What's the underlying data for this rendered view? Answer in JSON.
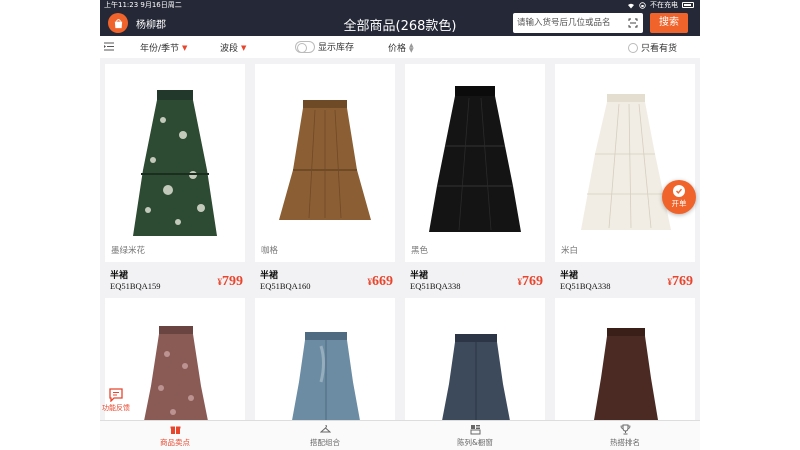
{
  "status": {
    "time_date": "上午11:23   9月16日周二",
    "charging": "不在充电"
  },
  "nav": {
    "user": "杨柳郡",
    "title": "全部商品(268款色)",
    "search_placeholder": "请输入货号后几位或品名",
    "search_button": "搜索"
  },
  "filters": {
    "season": "年份/季节",
    "wave": "波段",
    "show_stock": "显示库存",
    "price": "价格",
    "only_in_stock": "只看有货"
  },
  "products": [
    {
      "color": "墨绿米花",
      "category": "半裙",
      "code": "EQ51BQA159",
      "price": "799",
      "swatch": "#2d4a32"
    },
    {
      "color": "咖格",
      "category": "半裙",
      "code": "EQ51BQA160",
      "price": "669",
      "swatch": "#8b5e34"
    },
    {
      "color": "黑色",
      "category": "半裙",
      "code": "EQ51BQA338",
      "price": "769",
      "swatch": "#141414"
    },
    {
      "color": "米白",
      "category": "半裙",
      "code": "EQ51BQA338",
      "price": "769",
      "swatch": "#f1ede4"
    }
  ],
  "row2_swatches": [
    "#8a5a55",
    "#6b8ca3",
    "#3c4a5c",
    "#4a2a22"
  ],
  "currency": "¥",
  "floating": {
    "kaidan": "开单",
    "feedback": "功能反馈"
  },
  "tabs": [
    {
      "label": "商品卖点",
      "active": true
    },
    {
      "label": "搭配组合",
      "active": false
    },
    {
      "label": "陈列&橱窗",
      "active": false
    },
    {
      "label": "热搭排名",
      "active": false
    }
  ]
}
